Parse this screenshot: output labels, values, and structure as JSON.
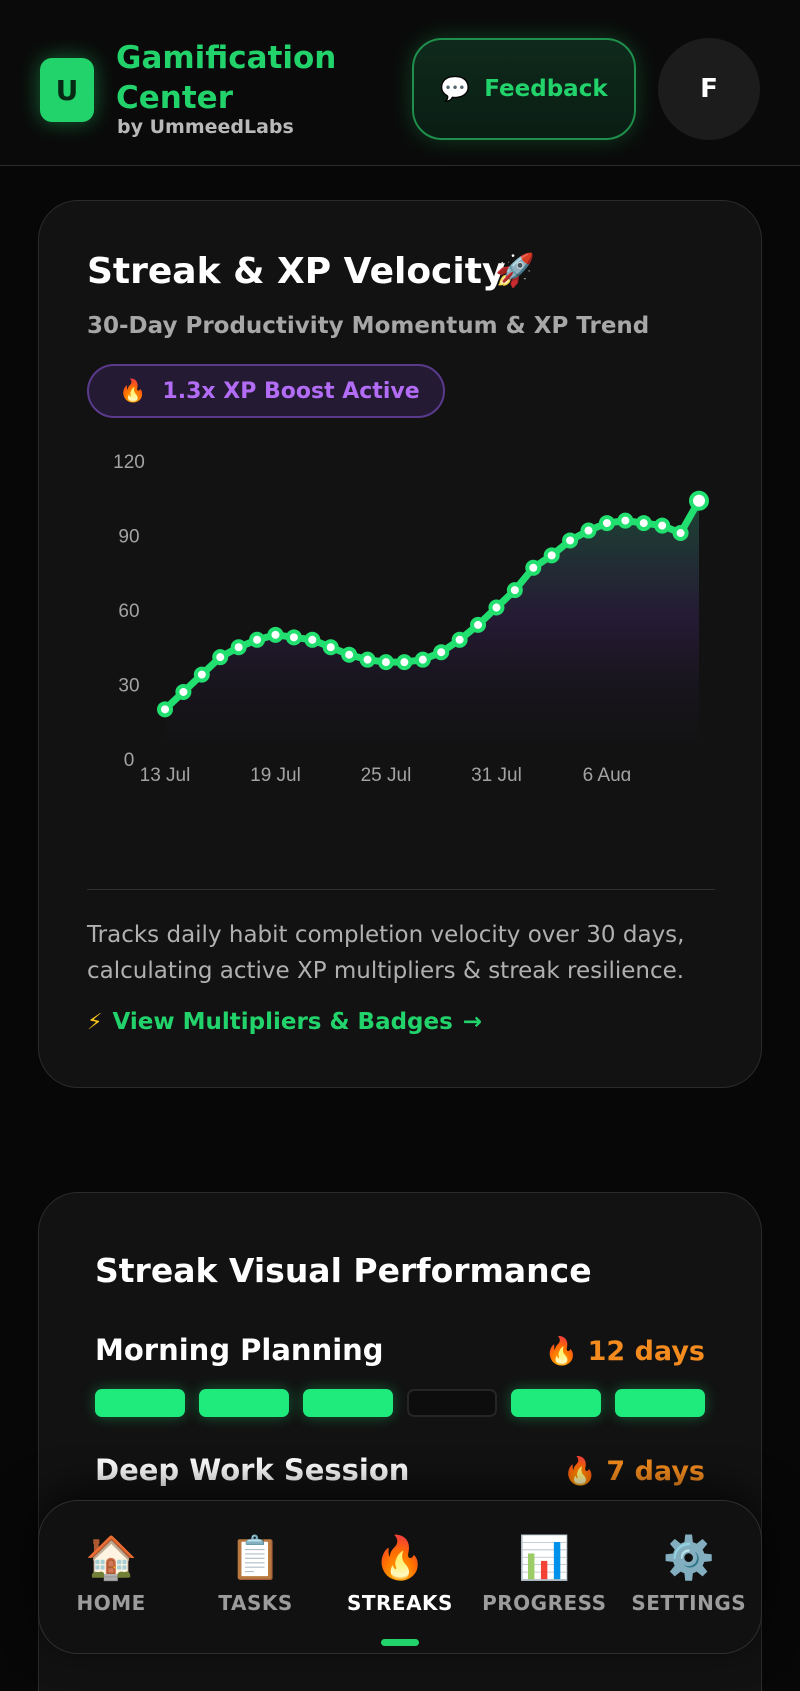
{
  "header": {
    "logo_letter": "U",
    "title": "Gamification Center",
    "subtitle": "by UmmeedLabs",
    "feedback_icon": "💬",
    "feedback_label": "Feedback",
    "avatar_letter": "F"
  },
  "velocity_card": {
    "title": "Streak & XP Velocity",
    "title_icon": "🚀",
    "subtitle": "30-Day Productivity Momentum & XP Trend",
    "boost_icon": "🔥",
    "boost_label": "1.3x XP Boost Active",
    "description": "Tracks daily habit completion velocity over 30 days, calculating active XP multipliers & streak resilience.",
    "link_icon": "⚡",
    "link_label": "View Multipliers & Badges",
    "link_arrow": "→"
  },
  "chart_data": {
    "type": "area",
    "x": [
      "13 Jul",
      "14 Jul",
      "15 Jul",
      "16 Jul",
      "17 Jul",
      "18 Jul",
      "19 Jul",
      "20 Jul",
      "21 Jul",
      "22 Jul",
      "23 Jul",
      "24 Jul",
      "25 Jul",
      "26 Jul",
      "27 Jul",
      "28 Jul",
      "29 Jul",
      "30 Jul",
      "31 Jul",
      "1 Aug",
      "2 Aug",
      "3 Aug",
      "4 Aug",
      "5 Aug",
      "6 Aug",
      "7 Aug",
      "8 Aug",
      "9 Aug",
      "10 Aug",
      "11 Aug"
    ],
    "values": [
      20,
      27,
      34,
      41,
      45,
      48,
      50,
      49,
      48,
      45,
      42,
      40,
      39,
      39,
      40,
      43,
      48,
      54,
      61,
      68,
      77,
      82,
      88,
      92,
      95,
      96,
      95,
      94,
      91,
      104
    ],
    "x_ticks": [
      "13 Jul",
      "19 Jul",
      "25 Jul",
      "31 Jul",
      "6 Aug"
    ],
    "y_ticks": [
      0,
      30,
      60,
      90,
      120
    ],
    "ylim": [
      0,
      120
    ],
    "grid": false,
    "colors": {
      "line": "#22e06f",
      "point_fill": "#ffffff",
      "area_top": "#1d4a37",
      "area_mid": "#2a1d3d"
    }
  },
  "streak_card": {
    "title": "Streak Visual Performance",
    "habits": [
      {
        "name": "Morning Planning",
        "streak_icon": "🔥",
        "streak_label": "12 days",
        "days": [
          true,
          true,
          true,
          false,
          true,
          true
        ]
      },
      {
        "name": "Deep Work Session",
        "streak_icon": "🔥",
        "streak_label": "7 days",
        "days": []
      }
    ]
  },
  "nav": {
    "items": [
      {
        "icon": "🏠",
        "label": "HOME",
        "active": false
      },
      {
        "icon": "📋",
        "label": "TASKS",
        "active": false
      },
      {
        "icon": "🔥",
        "label": "STREAKS",
        "active": true
      },
      {
        "icon": "📊",
        "label": "PROGRESS",
        "active": false
      },
      {
        "icon": "⚙️",
        "label": "SETTINGS",
        "active": false
      }
    ]
  },
  "colors": {
    "accent": "#22d36b",
    "background": "#070707",
    "card": "#121212",
    "boost": "#b26cf5",
    "streak": "#f38b1e"
  }
}
